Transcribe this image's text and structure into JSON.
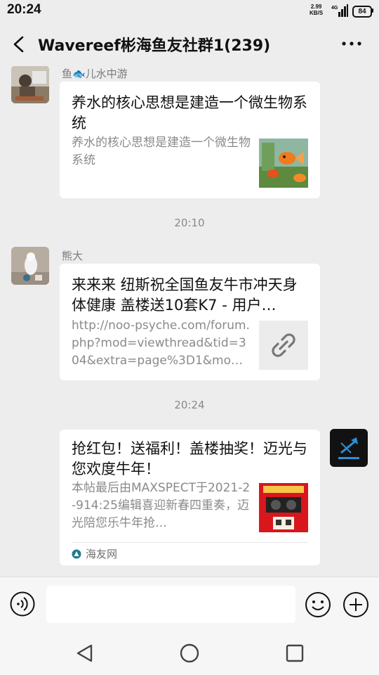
{
  "status_bar": {
    "time": "20:24",
    "net_speed_value": "2.99",
    "net_speed_unit": "KB/S",
    "network": "4G",
    "battery": "84"
  },
  "header": {
    "title": "Wavereef彬海鱼友社群1(239)"
  },
  "messages": [
    {
      "sender": "鱼🐟儿水中游",
      "title": "养水的核心思想是建造一个微生物系统",
      "desc": "养水的核心思想是建造一个微生物系统",
      "thumb_icon": "goldfish-thumbnail"
    },
    {
      "timestamp": "20:10"
    },
    {
      "sender": "熊大",
      "title": "来来来 纽斯祝全国鱼友牛市冲天身体健康 盖楼送10套K7 - 用户…",
      "desc": "http://noo-psyche.com/forum.php?mod=viewthread&tid=304&extra=page%3D1&mo…",
      "thumb_icon": "link-icon"
    },
    {
      "timestamp": "20:24"
    },
    {
      "title": "抢红包！送福利！盖楼抽奖！迈光与您欢度牛年！",
      "desc": "本帖最后由MAXSPECT于2021-2-914:25编辑喜迎新春四重奏，迈光陪您乐牛年抢…",
      "source": "海友网",
      "thumb_icon": "red-poster-thumbnail"
    }
  ],
  "colors": {
    "background": "#ededed",
    "card": "#ffffff",
    "secondary_text": "#8a8a8a"
  }
}
